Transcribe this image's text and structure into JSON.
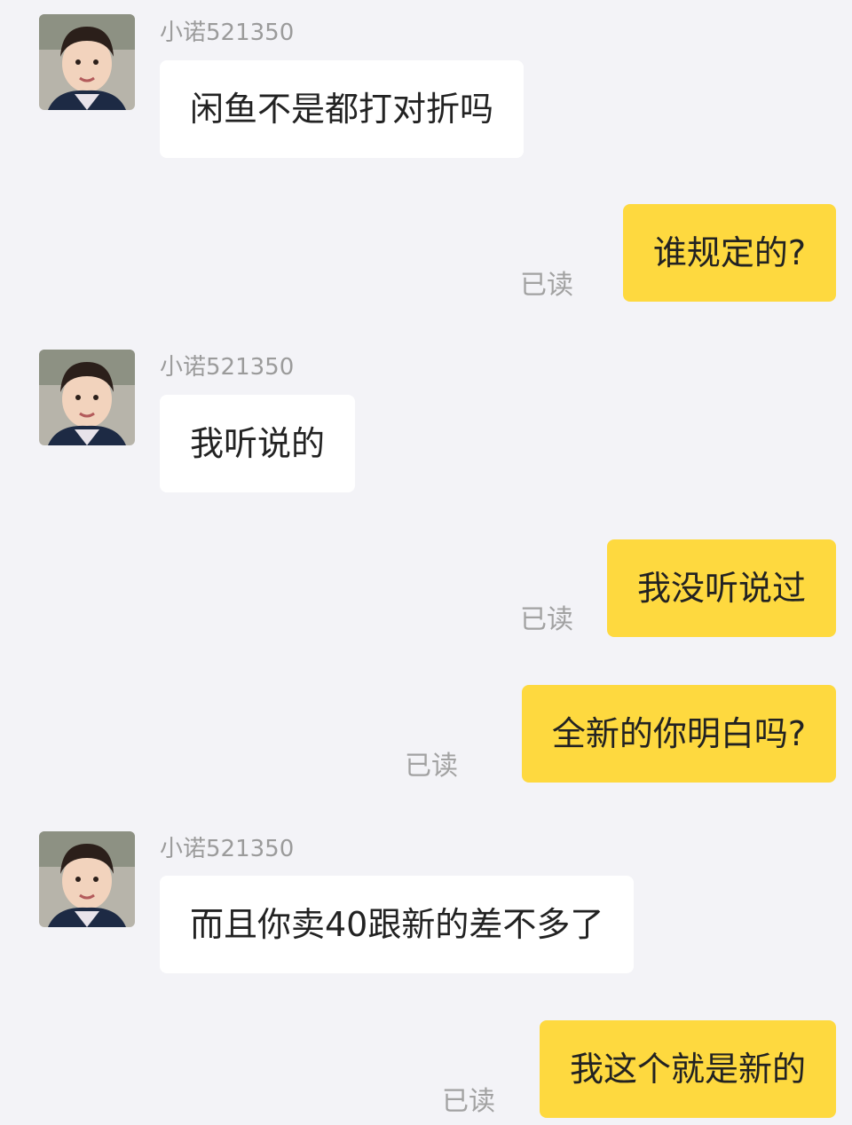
{
  "contact": {
    "name": "小诺521350"
  },
  "read_label": "已读",
  "messages": [
    {
      "from": "them",
      "text": "闲鱼不是都打对折吗"
    },
    {
      "from": "me",
      "text": "谁规定的?"
    },
    {
      "from": "them",
      "text": "我听说的"
    },
    {
      "from": "me",
      "text": "我没听说过"
    },
    {
      "from": "me",
      "text": "全新的你明白吗?"
    },
    {
      "from": "them",
      "text": "而且你卖40跟新的差不多了"
    },
    {
      "from": "me",
      "text": "我这个就是新的"
    }
  ],
  "colors": {
    "background": "#f3f3f7",
    "incoming_bubble": "#ffffff",
    "outgoing_bubble": "#fed93f",
    "meta_text": "#9b9b9b"
  }
}
